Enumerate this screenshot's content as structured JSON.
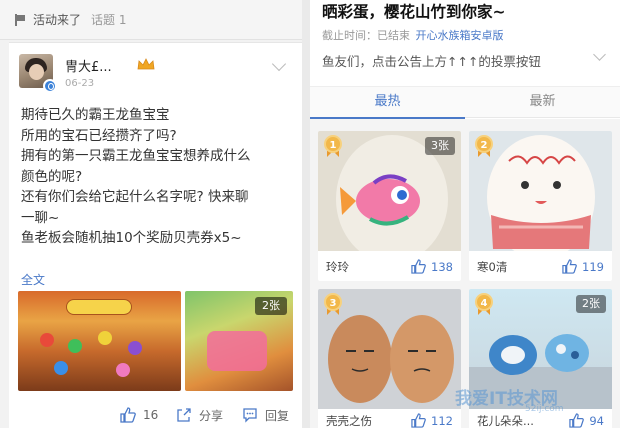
{
  "topic_header": {
    "title": "活动来了",
    "count_label": "话题 1"
  },
  "post": {
    "username": "冑大£...",
    "date": "06-23",
    "body_lines": [
      "期待已久的霸王龙鱼宝宝",
      "所用的宝石已经攒齐了吗?",
      "拥有的第一只霸王龙鱼宝宝想养成什么",
      "颜色的呢?",
      "还有你们会给它起什么名字呢? 快来聊",
      "一聊~",
      "鱼老板会随机抽10个奖励贝壳券x5~"
    ],
    "full_text_link": "全文",
    "image_count_tag": "2张",
    "actions": {
      "like_count": "16",
      "share_label": "分享",
      "reply_label": "回复"
    }
  },
  "event": {
    "title": "晒彩蛋，樱花山竹到你家~",
    "deadline_label": "截止时间：已结束",
    "link_text": "开心水族箱安卓版",
    "notice": "鱼友们，点击公告上方↑↑↑的投票按钮",
    "tabs": [
      {
        "label": "最热",
        "active": true
      },
      {
        "label": "最新",
        "active": false
      }
    ],
    "entries": [
      {
        "rank": "1",
        "name": "玲玲",
        "likes": "138",
        "image_count": "3张"
      },
      {
        "rank": "2",
        "name": "寒0清",
        "likes": "119",
        "image_count": ""
      },
      {
        "rank": "3",
        "name": "壳壳之伤",
        "likes": "112",
        "image_count": ""
      },
      {
        "rank": "4",
        "name": "花儿朵朵...",
        "likes": "94",
        "image_count": "2张"
      }
    ]
  },
  "watermark": {
    "text": "我爱IT技术网",
    "sub": "52ij.com"
  },
  "colors": {
    "accent_blue": "#4a79c8",
    "medal_gold": "#f2b84a"
  }
}
